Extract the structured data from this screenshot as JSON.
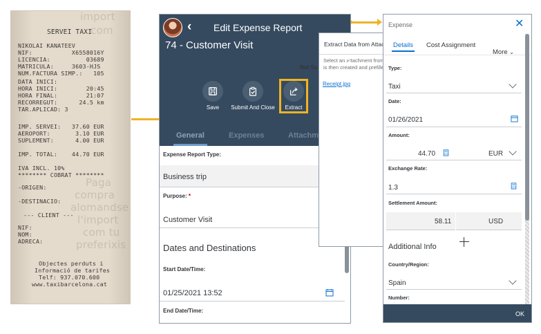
{
  "receipt": {
    "header": "SERVEI TAXI",
    "lines": [
      "NIKOLAI KANATEEV",
      "NIF:           X6558016Y",
      "LICENCIA:          03689",
      "MATRICULA:     3603-HJS",
      "NUM.FACTURA SIMP.:   105",
      "DATA INICI:",
      "HORA INICI:        20:45",
      "HORA FINAL:        21:07",
      "RECORREGUT:      24.5 km",
      "TAR.APLICAD: 3"
    ],
    "amounts": [
      "IMP. SERVEI:   37.60 EUR",
      "AEROPORT:       3.10 EUR",
      "SUPLEMENT:      4.00 EUR"
    ],
    "total": "IMP. TOTAL:    44.70 EUR",
    "vat": "IVA INCL. 10%",
    "cobrat": "******** COBRAT ********",
    "origen": "-ORIGEN:",
    "destinacio": "-DESTINACIO:",
    "client": "--- CLIENT ---",
    "client_lines": [
      "NIF:",
      "NOM:",
      "ADRECA:"
    ],
    "footer_lines": [
      "Objectes perduts i",
      "Informació de tarifes",
      "Telf: 937.070.600",
      "www.taxibarcelona.cat"
    ],
    "bg_words": [
      "Paga",
      "compra",
      "alomandse",
      "l'import",
      "com tu",
      "preferixis",
      "import",
      "com"
    ]
  },
  "phone": {
    "title": "Edit Expense Report",
    "report_name": "74 - Customer Visit",
    "actions": [
      {
        "label": "Save"
      },
      {
        "label": "Submit And Close"
      },
      {
        "label": "Extract"
      }
    ],
    "tabs": [
      "General",
      "Expenses",
      "Attachments"
    ],
    "form": {
      "type_label": "Expense Report Type:",
      "type_value": "Business trip",
      "purpose_label": "Purpose:",
      "purpose_required": "*",
      "purpose_value": "Customer Visit",
      "section_title": "Dates and Destinations",
      "start_label": "Start Date/Time:",
      "start_value": "01/25/2021 13:52",
      "end_label": "End Date/Time:"
    },
    "overlay_text": [
      "S",
      "Not Su"
    ]
  },
  "extract": {
    "title": "Extract Data from Attachment",
    "description_lines": [
      "Select an attachment from which the expense",
      "is then created and prefilled."
    ],
    "attachment": "Receipt.jpg"
  },
  "expense": {
    "title": "Expense",
    "tabs": {
      "details": "Details",
      "cost": "Cost Assignment",
      "more": "More"
    },
    "type_label": "Type:",
    "type_value": "Taxi",
    "date_label": "Date:",
    "date_value": "01/26/2021",
    "amount_label": "Amount:",
    "amount_value": "44.70",
    "currency": "EUR",
    "rate_label": "Exchange Rate:",
    "rate_value": "1.3",
    "settle_label": "Settlement Amount:",
    "settle_value": "58.11",
    "settle_currency": "USD",
    "section_title": "Additional Info",
    "country_label": "Country/Region:",
    "country_value": "Spain",
    "number_label": "Number:",
    "ok_label": "OK"
  },
  "colors": {
    "shell": "#354a5f",
    "highlight": "#f0b323",
    "link": "#0a6ed1"
  }
}
